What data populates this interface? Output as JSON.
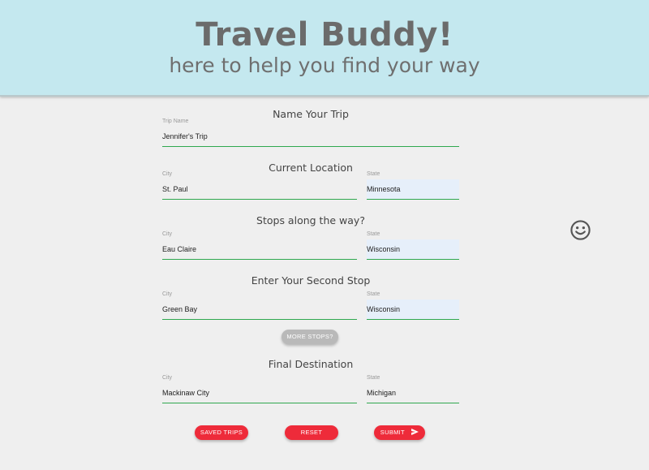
{
  "header": {
    "title": "Travel Buddy!",
    "subtitle": "here to help you find your way"
  },
  "trip_name": {
    "heading": "Name Your Trip",
    "label": "Trip Name",
    "value": "Jennifer's Trip"
  },
  "current_location": {
    "heading": "Current Location",
    "city_label": "City",
    "city_value": "St. Paul",
    "state_label": "State",
    "state_value": "Minnesota"
  },
  "first_stop": {
    "heading": "Stops along the way?",
    "city_label": "City",
    "city_value": "Eau Claire",
    "state_label": "State",
    "state_value": "Wisconsin"
  },
  "second_stop": {
    "heading": "Enter Your Second Stop",
    "city_label": "City",
    "city_value": "Green Bay",
    "state_label": "State",
    "state_value": "Wisconsin"
  },
  "more_stops_label": "MORE STOPS?",
  "final_destination": {
    "heading": "Final Destination",
    "city_label": "City",
    "city_value": "Mackinaw City",
    "state_label": "State",
    "state_value": "Michigan"
  },
  "actions": {
    "saved_trips_label": "SAVED TRIPS",
    "reset_label": "RESET",
    "submit_label": "SUBMIT"
  },
  "icons": {
    "submit": "send-icon",
    "side": "smiley-face-icon"
  },
  "colors": {
    "header_bg": "#c4e8ef",
    "accent_red": "#ee2b3a",
    "underline_green": "#2fa84f",
    "autofill_bg": "#e6effa"
  }
}
